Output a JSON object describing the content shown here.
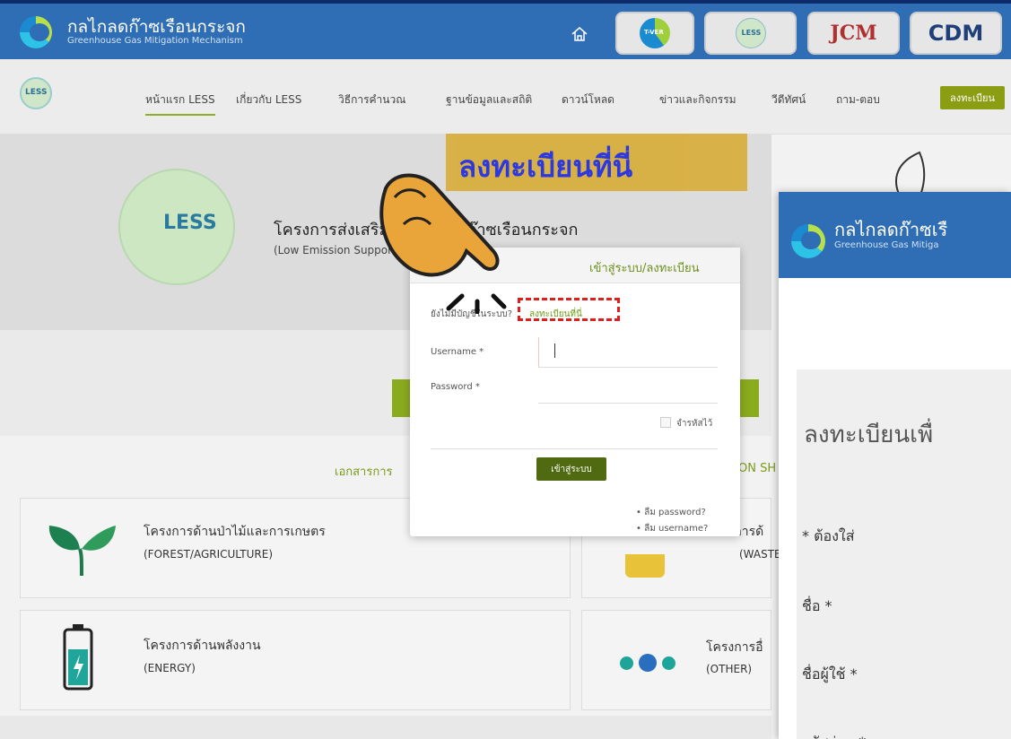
{
  "header": {
    "org_th": "กลไกลดก๊าซเรือนกระจก",
    "org_en": "Greenhouse Gas Mitigation Mechanism",
    "badges": [
      "T-VER",
      "LESS",
      "JCM",
      "CDM"
    ]
  },
  "nav": {
    "logo": "LESS",
    "items": [
      "หน้าแรก LESS",
      "เกี่ยวกับ LESS",
      "วิธีการคำนวณ",
      "ฐานข้อมูลและสถิติ",
      "ดาวน์โหลด",
      "ข่าวและกิจกรรม",
      "วีดีทัศน์",
      "ถาม-ตอบ"
    ],
    "register": "ลงทะเบียน"
  },
  "hero": {
    "logo_text": "LESS",
    "title": "โครงการส่งเสริมกิจกรรมลดก๊าซเรือนกระจก",
    "subtitle": "(Low Emission Support Scheme: LESS)"
  },
  "sections": {
    "docs": "เอกสารการ",
    "docs_right": "ON SH"
  },
  "cards": [
    {
      "title": "โครงการด้านป่าไม้และการเกษตร",
      "sub": "(FOREST/AGRICULTURE)"
    },
    {
      "title": "โครงการด้",
      "sub": "(WASTE)"
    },
    {
      "title": "โครงการด้านพลังงาน",
      "sub": "(ENERGY)"
    },
    {
      "title": "โครงการอื่",
      "sub": "(OTHER)"
    }
  ],
  "modal": {
    "title": "เข้าสู่ระบบ/ลงทะเบียน",
    "no_account": "ยังไม่มีบัญชีในระบบ?",
    "register_link": "ลงทะเบียนที่นี่",
    "username_label": "Username *",
    "password_label": "Password *",
    "remember": "จำรหัสไว้",
    "login": "เข้าสู่ระบบ",
    "forgot_password": "•  ลืม password?",
    "forgot_username": "•  ลืม username?"
  },
  "callout": "ลงทะเบียนที่นี่",
  "right_panel": {
    "org_th": "กลไกลดก๊าซเรื",
    "org_en": "Greenhouse Gas Mitiga",
    "heading": "ลงทะเบียนเพื่",
    "required_note": "* ต้องใส่",
    "fields": [
      "ชื่อ *",
      "ชื่อผู้ใช้ *",
      "รหัสผ่าน *"
    ]
  },
  "colors": {
    "primary": "#2f6db4",
    "accent": "#8bab1e",
    "dark_green": "#4f6a10",
    "callout_bg": "#d7ae3f",
    "callout_text": "#2430e0",
    "dash": "#e01e1e"
  }
}
